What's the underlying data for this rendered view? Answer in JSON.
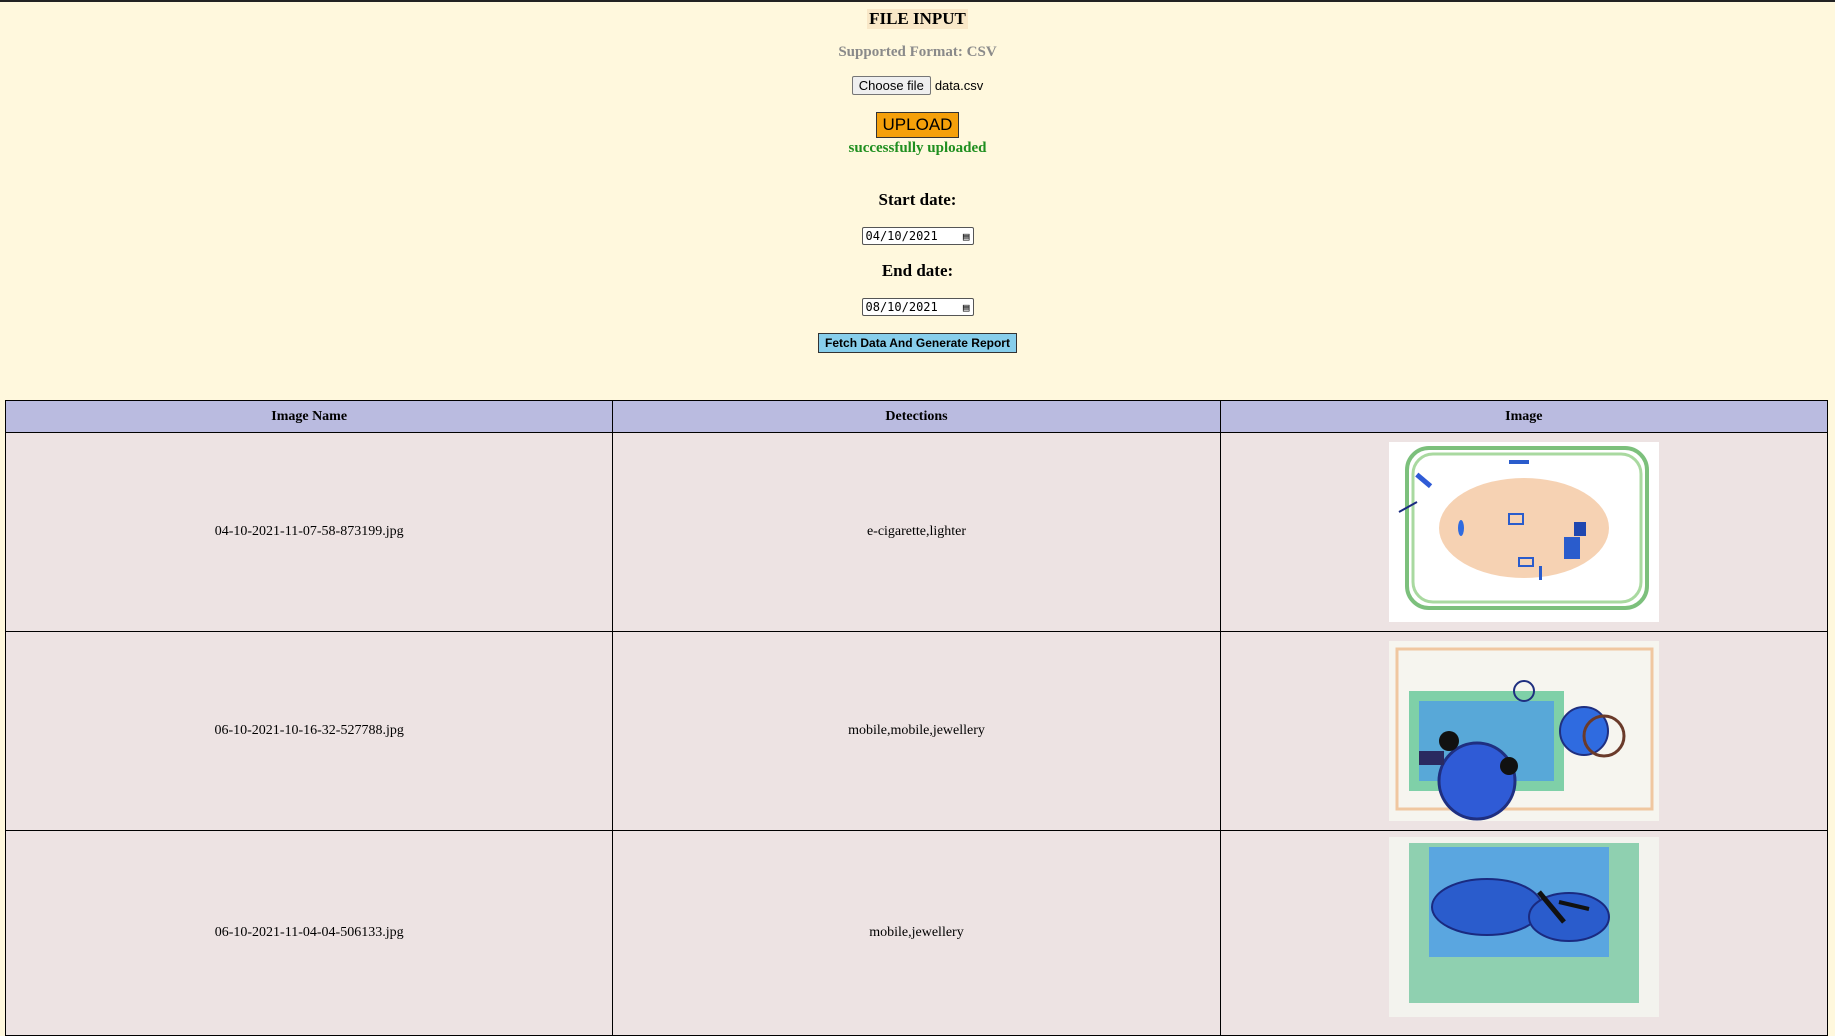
{
  "header": {
    "title": "FILE INPUT",
    "supported_format": "Supported Format: CSV"
  },
  "file_input": {
    "choose_label": "Choose file",
    "file_name": "data.csv"
  },
  "upload": {
    "label": "UPLOAD",
    "status": "successfully uploaded",
    "status_color": "#1f8f1f"
  },
  "dates": {
    "start_label": "Start date:",
    "start_value": "04/10/2021",
    "end_label": "End date:",
    "end_value": "08/10/2021"
  },
  "fetch_button": "Fetch Data And Generate Report",
  "table": {
    "headers": [
      "Image Name",
      "Detections",
      "Image"
    ],
    "rows": [
      {
        "name": "04-10-2021-11-07-58-873199.jpg",
        "detections": "e-cigarette,lighter"
      },
      {
        "name": "06-10-2021-10-16-32-527788.jpg",
        "detections": "mobile,mobile,jewellery"
      },
      {
        "name": "06-10-2021-11-04-04-506133.jpg",
        "detections": "mobile,jewellery"
      }
    ]
  }
}
